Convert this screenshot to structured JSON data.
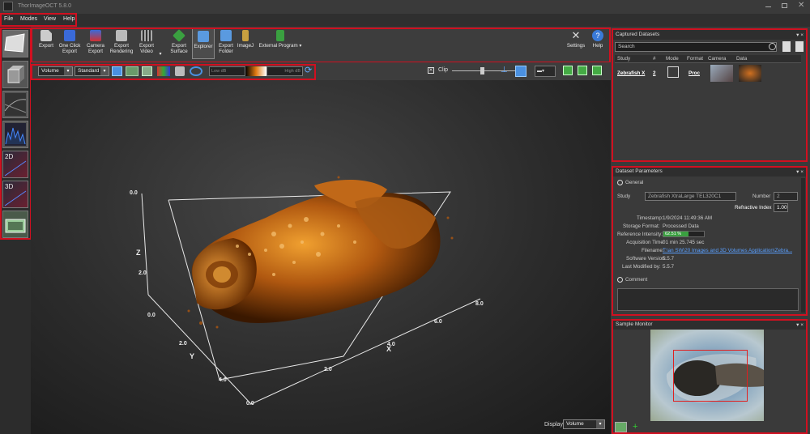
{
  "app": {
    "title": "ThorImageOCT 5.8.0"
  },
  "menu": [
    "File",
    "Modes",
    "View",
    "Help"
  ],
  "toolbar": {
    "export": "Export",
    "one_click_export": [
      "One Click",
      "Export"
    ],
    "camera_export": [
      "Camera",
      "Export"
    ],
    "export_rendering": [
      "Export",
      "Rendering"
    ],
    "export_video": [
      "Export",
      "Video"
    ],
    "export_surface": [
      "Export",
      "Surface"
    ],
    "explorer": "Explorer",
    "export_folder": [
      "Export",
      "Folder"
    ],
    "imagej": "ImageJ",
    "external_program": "External Program",
    "settings": "Settings",
    "help": "Help"
  },
  "subbar": {
    "mode_value": "Volume",
    "preset_value": "Standard",
    "low_db": "Low dB",
    "high_db": "High dB",
    "clip_label": "Clip"
  },
  "viewport": {
    "axis_labels": {
      "x": "X",
      "y": "Y",
      "z": "Z"
    },
    "ticks": {
      "origin": "0.0",
      "z_top": "0.0",
      "z_mid": "2.0",
      "y_2": "2.0",
      "y_4": "4.0",
      "x_2": "2.0",
      "x_4": "4.0",
      "x_6": "6.0",
      "x_8": "8.0"
    },
    "display_label": "Display",
    "display_value": "Volume"
  },
  "captured": {
    "title": "Captured Datasets",
    "search_placeholder": "Search",
    "columns": [
      "Study",
      "#",
      "Mode",
      "Format",
      "Camera",
      "Data"
    ],
    "rows": [
      {
        "study": "Zebrafish X",
        "num": "2",
        "format": "Proc"
      }
    ]
  },
  "params": {
    "title": "Dataset Parameters",
    "general": "General",
    "study_label": "Study",
    "study_value": "Zebrafish XtraLarge TEL320C1",
    "number_label": "Number",
    "number_value": "2",
    "refractive_label": "Refractive Index",
    "refractive_value": "1.00",
    "timestamp_label": "Timestamp:",
    "timestamp_value": "1/9/2024 11:49:36 AM",
    "storage_label": "Storage Format:",
    "storage_value": "Processed Data",
    "refint_label": "Reference Intensity:",
    "refint_value": "62.51 %",
    "refint_fraction": 0.6251,
    "acq_label": "Acquisition Time:",
    "acq_value": "01 min 25.745 sec",
    "filename_label": "Filename:",
    "filename_value": "T:\\an SW\\20 Images and 3D Volumes Application\\Zebra...",
    "software_label": "Software Version:",
    "software_value": "5.5.7",
    "modified_label": "Last Modified by:",
    "modified_value": "5.5.7",
    "comment": "Comment"
  },
  "monitor": {
    "title": "Sample Monitor"
  },
  "colors": {
    "accent_red": "#d01020",
    "orange": "#e07a10"
  }
}
